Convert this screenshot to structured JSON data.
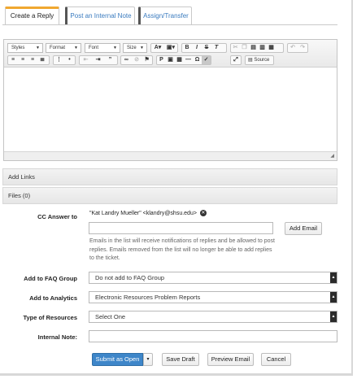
{
  "tabs": [
    {
      "label": "Create a Reply",
      "active": true
    },
    {
      "label": "Post an Internal Note",
      "active": false
    },
    {
      "label": "Assign/Transfer",
      "active": false
    }
  ],
  "editor": {
    "selects": {
      "styles": "Styles",
      "format": "Format",
      "font": "Font",
      "size": "Size"
    },
    "source_label": "Source"
  },
  "sections": {
    "add_links": "Add Links",
    "files": "Files (0)"
  },
  "form": {
    "cc_label": "CC Answer to",
    "cc_entry": "\"Kat Landry Mueller\" <klandry@shsu.edu>",
    "add_email_label": "Add Email",
    "cc_help": "Emails in the list will receive notifications of replies and be allowed to post replies. Emails removed from the list will no longer be able to add replies to the ticket.",
    "faq_label": "Add to FAQ Group",
    "faq_value": "Do not add to FAQ Group",
    "analytics_label": "Add to Analytics",
    "analytics_value": "Electronic Resources Problem Reports",
    "resources_label": "Type of Resources",
    "resources_value": "Select One",
    "internal_note_label": "Internal Note:",
    "internal_note_value": ""
  },
  "actions": {
    "submit": "Submit as Open",
    "submit_caret": "▾",
    "save_draft": "Save Draft",
    "preview": "Preview Email",
    "cancel": "Cancel"
  },
  "colors": {
    "accent_tab": "#f0a830",
    "primary": "#3e86c9",
    "link": "#3a7bbf"
  }
}
